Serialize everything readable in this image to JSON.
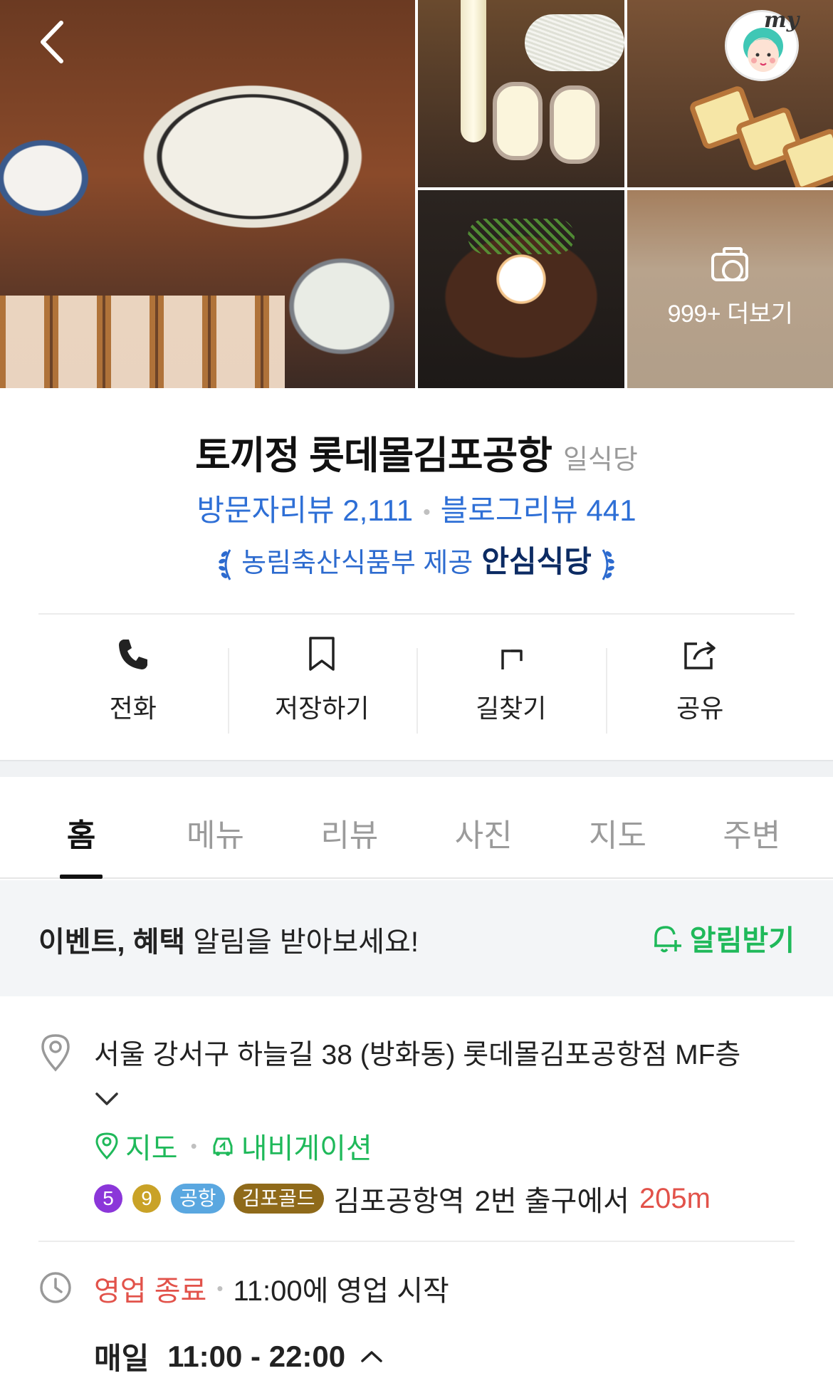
{
  "header": {
    "back_icon": "chevron-left-icon",
    "my_label": "my",
    "photo_more": "999+ 더보기"
  },
  "place": {
    "name": "토끼정 롯데몰김포공항",
    "category": "일식당",
    "visitor_reviews": "방문자리뷰 2,111",
    "blog_reviews": "블로그리뷰 441",
    "certification_provider": "농림축산식품부 제공",
    "certification_name": "안심식당"
  },
  "actions": [
    {
      "label": "전화",
      "icon": "phone-icon"
    },
    {
      "label": "저장하기",
      "icon": "bookmark-icon"
    },
    {
      "label": "길찾기",
      "icon": "directions-icon"
    },
    {
      "label": "공유",
      "icon": "share-icon"
    }
  ],
  "tabs": [
    {
      "label": "홈",
      "active": true
    },
    {
      "label": "메뉴",
      "active": false
    },
    {
      "label": "리뷰",
      "active": false
    },
    {
      "label": "사진",
      "active": false
    },
    {
      "label": "지도",
      "active": false
    },
    {
      "label": "주변",
      "active": false
    }
  ],
  "notice": {
    "bold_text": "이벤트, 혜택",
    "text": " 알림을 받아보세요!",
    "action": "알림받기"
  },
  "address": {
    "text": "서울 강서구 하늘길 38 (방화동) 롯데몰김포공항점 MF층",
    "map_link": "지도",
    "navigation_link": "내비게이션",
    "subway": {
      "lines": [
        {
          "label": "5",
          "color": "#8b36d9"
        },
        {
          "label": "9",
          "color": "#c9a227"
        },
        {
          "label": "공항",
          "color": "#5aa7e0"
        },
        {
          "label": "김포골드",
          "color": "#8f6a1a"
        }
      ],
      "station": "김포공항역",
      "exit": "2번 출구에서",
      "distance": "205m"
    }
  },
  "hours": {
    "status": "영업 종료",
    "next_open": "11:00에 영업 시작",
    "day": "매일",
    "time": "11:00 - 22:00"
  },
  "colors": {
    "accent_blue": "#2e6fd6",
    "accent_green": "#1fb95a",
    "accent_red": "#e2524a",
    "navy": "#0c2b63"
  }
}
